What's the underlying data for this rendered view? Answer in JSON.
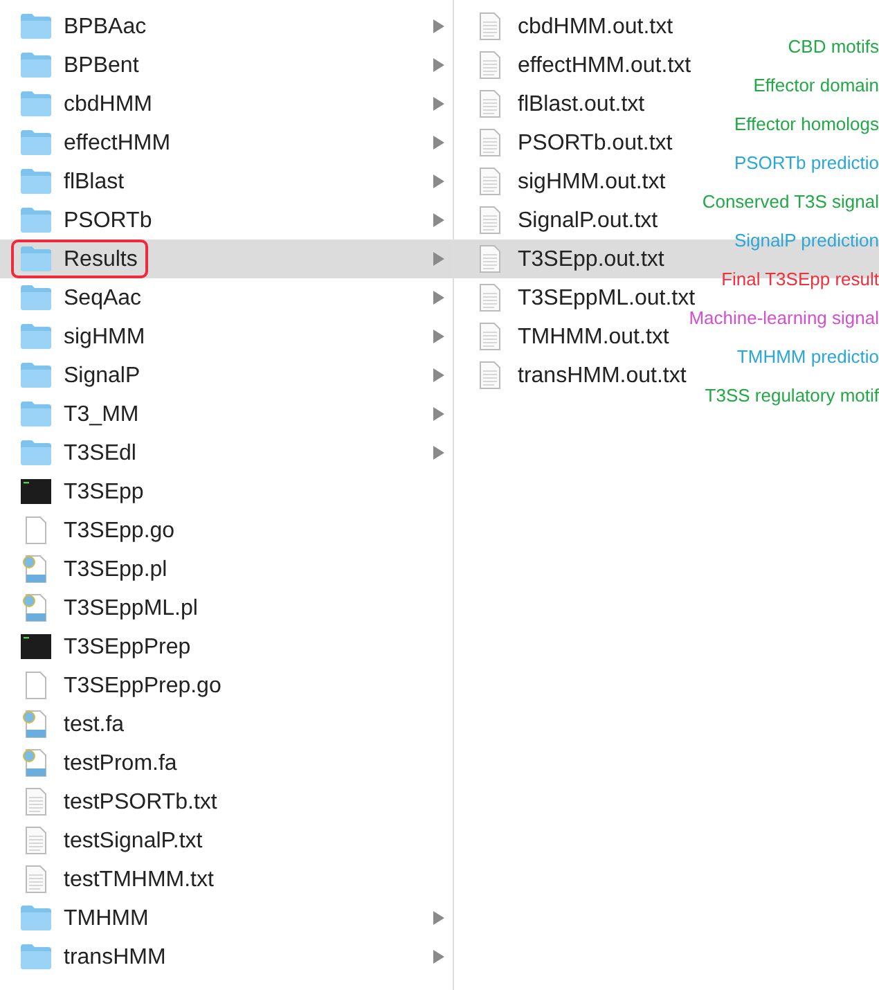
{
  "left_column": {
    "items": [
      {
        "name": "BPBAac",
        "kind": "folder",
        "selected": false,
        "circled": false
      },
      {
        "name": "BPBent",
        "kind": "folder",
        "selected": false,
        "circled": false
      },
      {
        "name": "cbdHMM",
        "kind": "folder",
        "selected": false,
        "circled": false
      },
      {
        "name": "effectHMM",
        "kind": "folder",
        "selected": false,
        "circled": false
      },
      {
        "name": "flBlast",
        "kind": "folder",
        "selected": false,
        "circled": false
      },
      {
        "name": "PSORTb",
        "kind": "folder",
        "selected": false,
        "circled": false
      },
      {
        "name": "Results",
        "kind": "folder",
        "selected": true,
        "circled": true
      },
      {
        "name": "SeqAac",
        "kind": "folder",
        "selected": false,
        "circled": false
      },
      {
        "name": "sigHMM",
        "kind": "folder",
        "selected": false,
        "circled": false
      },
      {
        "name": "SignalP",
        "kind": "folder",
        "selected": false,
        "circled": false
      },
      {
        "name": "T3_MM",
        "kind": "folder",
        "selected": false,
        "circled": false
      },
      {
        "name": "T3SEdl",
        "kind": "folder",
        "selected": false,
        "circled": false
      },
      {
        "name": "T3SEpp",
        "kind": "executable",
        "selected": false,
        "circled": false
      },
      {
        "name": "T3SEpp.go",
        "kind": "blank",
        "selected": false,
        "circled": false
      },
      {
        "name": "T3SEpp.pl",
        "kind": "script",
        "selected": false,
        "circled": false
      },
      {
        "name": "T3SEppML.pl",
        "kind": "script",
        "selected": false,
        "circled": false
      },
      {
        "name": "T3SEppPrep",
        "kind": "executable",
        "selected": false,
        "circled": false
      },
      {
        "name": "T3SEppPrep.go",
        "kind": "blank",
        "selected": false,
        "circled": false
      },
      {
        "name": "test.fa",
        "kind": "script",
        "selected": false,
        "circled": false
      },
      {
        "name": "testProm.fa",
        "kind": "script",
        "selected": false,
        "circled": false
      },
      {
        "name": "testPSORTb.txt",
        "kind": "text",
        "selected": false,
        "circled": false
      },
      {
        "name": "testSignalP.txt",
        "kind": "text",
        "selected": false,
        "circled": false
      },
      {
        "name": "testTMHMM.txt",
        "kind": "text",
        "selected": false,
        "circled": false
      },
      {
        "name": "TMHMM",
        "kind": "folder",
        "selected": false,
        "circled": false
      },
      {
        "name": "transHMM",
        "kind": "folder",
        "selected": false,
        "circled": false
      }
    ]
  },
  "right_column": {
    "items": [
      {
        "name": "cbdHMM.out.txt",
        "selected": false
      },
      {
        "name": "effectHMM.out.txt",
        "selected": false
      },
      {
        "name": "flBlast.out.txt",
        "selected": false
      },
      {
        "name": "PSORTb.out.txt",
        "selected": false
      },
      {
        "name": "sigHMM.out.txt",
        "selected": false
      },
      {
        "name": "SignalP.out.txt",
        "selected": false
      },
      {
        "name": "T3SEpp.out.txt",
        "selected": true
      },
      {
        "name": "T3SEppML.out.txt",
        "selected": false
      },
      {
        "name": "TMHMM.out.txt",
        "selected": false
      },
      {
        "name": "transHMM.out.txt",
        "selected": false
      }
    ],
    "annotations": [
      {
        "text": "CBD motifs",
        "color": "#22a845"
      },
      {
        "text": "Effector domain",
        "color": "#22a845"
      },
      {
        "text": "Effector homologs",
        "color": "#22a845"
      },
      {
        "text": "PSORTb predictio",
        "color": "#2aa6d8"
      },
      {
        "text": "Conserved T3S signal",
        "color": "#22a845"
      },
      {
        "text": "SignalP prediction",
        "color": "#2aa6d8"
      },
      {
        "text": "Final T3SEpp result",
        "color": "#f0303c"
      },
      {
        "text": "Machine-learning signal",
        "color": "#d24fd0"
      },
      {
        "text": "TMHMM predictio",
        "color": "#2aa6d8"
      },
      {
        "text": "T3SS regulatory motif",
        "color": "#22a845"
      }
    ]
  }
}
